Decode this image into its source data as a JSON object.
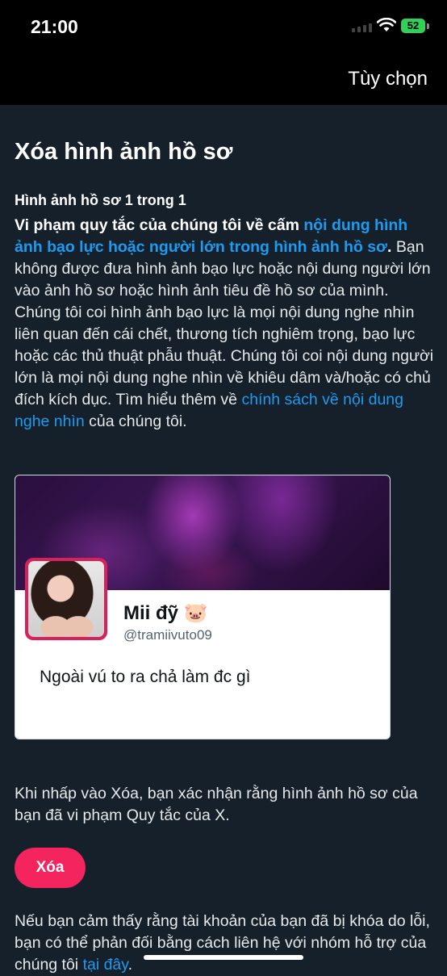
{
  "status_bar": {
    "time": "21:00",
    "battery": "52"
  },
  "nav": {
    "options_label": "Tùy chọn"
  },
  "page": {
    "title": "Xóa hình ảnh hồ sơ",
    "count": "Hình ảnh hồ sơ 1 trong 1",
    "violation_prefix": "Vi phạm quy tắc của chúng tôi về cấm ",
    "violation_link": "nội dung hình ảnh bạo lực hoặc người lớn trong hình ảnh hồ sơ",
    "violation_suffix": ".",
    "body_text": " Bạn không được đưa hình ảnh bạo lực hoặc nội dung người lớn vào ảnh hồ sơ hoặc hình ảnh tiêu đề hồ sơ của mình. Chúng tôi coi hình ảnh bạo lực là mọi nội dung nghe nhìn liên quan đến cái chết, thương tích nghiêm trọng, bạo lực hoặc các thủ thuật phẫu thuật. Chúng tôi coi nội dung người lớn là mọi nội dung nghe nhìn về khiêu dâm và/hoặc có chủ đích kích dục. Tìm hiểu thêm về ",
    "policy_link": "chính sách về nội dung nghe nhìn",
    "body_suffix": " của chúng tôi."
  },
  "profile_card": {
    "name": "Mii đỹ 🐷",
    "handle": "@tramiivuto09",
    "bio": "Ngoài vú to ra chả làm đc gì"
  },
  "confirm_text": "Khi nhấp vào Xóa, bạn xác nhận rằng hình ảnh hồ sơ của bạn đã vi phạm Quy tắc của X.",
  "delete_button": "Xóa",
  "appeal": {
    "text": "Nếu bạn cảm thấy rằng tài khoản của bạn đã bị khóa do lỗi, bạn có thể phản đối bằng cách liên hệ với nhóm hỗ trợ của chúng tôi ",
    "link": "tại đây",
    "suffix": "."
  },
  "colors": {
    "background": "#15202b",
    "link": "#1d9bf0",
    "button": "#f4245e"
  }
}
